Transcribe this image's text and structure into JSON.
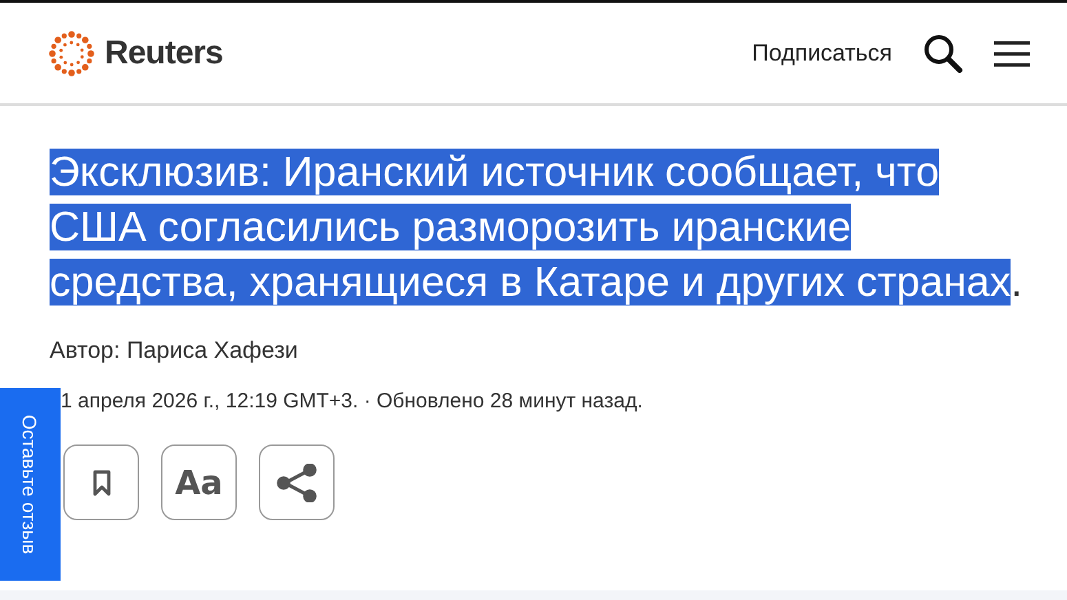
{
  "header": {
    "logo": "Reuters",
    "subscribe": "Подписаться"
  },
  "article": {
    "title": "Эксклюзив: Иранский источник сообщает, что США согласились разморозить иранские средства, хранящиеся в Катаре и других странах",
    "title_end": ".",
    "highlighted": true,
    "byline": "Автор: Париса Хафези",
    "dateline": "1 апреля 2026 г., 12:19 GMT+3. · Обновлено 28 минут назад.",
    "tools": [
      {
        "kind": "bookmark"
      },
      {
        "kind": "text",
        "label": "Aa"
      },
      {
        "kind": "share"
      }
    ]
  },
  "feedback": "Оставьте отзыв"
}
